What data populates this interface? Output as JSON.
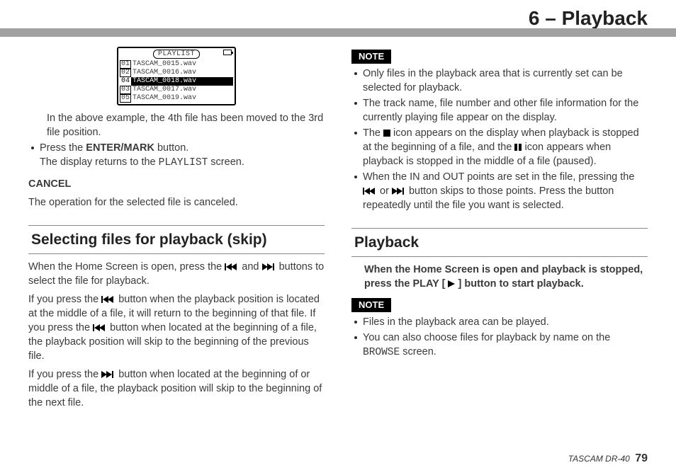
{
  "header": {
    "chapter": "6 – Playback"
  },
  "lcd": {
    "title": "PLAYLIST",
    "rows": [
      {
        "num": "01",
        "name": "TASCAM_0015.wav",
        "selected": false
      },
      {
        "num": "02",
        "name": "TASCAM_0016.wav",
        "selected": false
      },
      {
        "num": "04",
        "name": "TASCAM_0018.wav",
        "selected": true
      },
      {
        "num": "03",
        "name": "TASCAM_0017.wav",
        "selected": false
      },
      {
        "num": "05",
        "name": "TASCAM_0019.wav",
        "selected": false
      }
    ]
  },
  "left": {
    "caption": "In the above example, the 4th file has been moved to the 3rd file position.",
    "press_prefix": "Press the ",
    "enter_mark": "ENTER/MARK",
    "press_suffix": " button.",
    "return_prefix": "The display returns to the ",
    "return_mono": "PLAYLIST",
    "return_suffix": " screen.",
    "cancel_h": "CANCEL",
    "cancel_body": "The operation for the selected file is canceled.",
    "section_title": "Selecting files for playback (skip)",
    "p1a": "When the Home Screen is open, press the ",
    "p1b": " and ",
    "p1c": " buttons to select the file for playback.",
    "p2a": "If you press the ",
    "p2b": " button when the playback position is located at the middle of a file, it will return to the beginning of that file. If you press the ",
    "p2c": " button when located at the beginning of a file, the playback position will skip to the beginning of the previous file.",
    "p3a": "If you press the ",
    "p3b": " button when located at the beginning of or middle of a file, the playback position will skip to the beginning of the next file."
  },
  "right": {
    "note_label": "NOTE",
    "n1": "Only files in the playback area that is currently set can be selected for playback.",
    "n2": "The track name, file number and other file information for the currently playing file appear on the display.",
    "n3a": "The ",
    "n3b": " icon appears on the display when playback is stopped at the beginning of a file, and the ",
    "n3c": " icon appears when playback is stopped in the middle of a file (paused).",
    "n4a": "When the IN and OUT points are set in the file, pressing the ",
    "n4b": " or ",
    "n4c": " button skips to those points. Press the button repeatedly until the file you want is selected.",
    "section_title": "Playback",
    "instruct_a": "When the Home Screen is open and playback is stopped, press the PLAY [",
    "instruct_b": "] button to start playback.",
    "note2_label": "NOTE",
    "b1": "Files in the playback area can be played.",
    "b2a": "You can also choose files for playback by name on the ",
    "b2mono": "BROWSE",
    "b2b": " screen."
  },
  "footer": {
    "model": "TASCAM DR-40",
    "page": "79"
  }
}
